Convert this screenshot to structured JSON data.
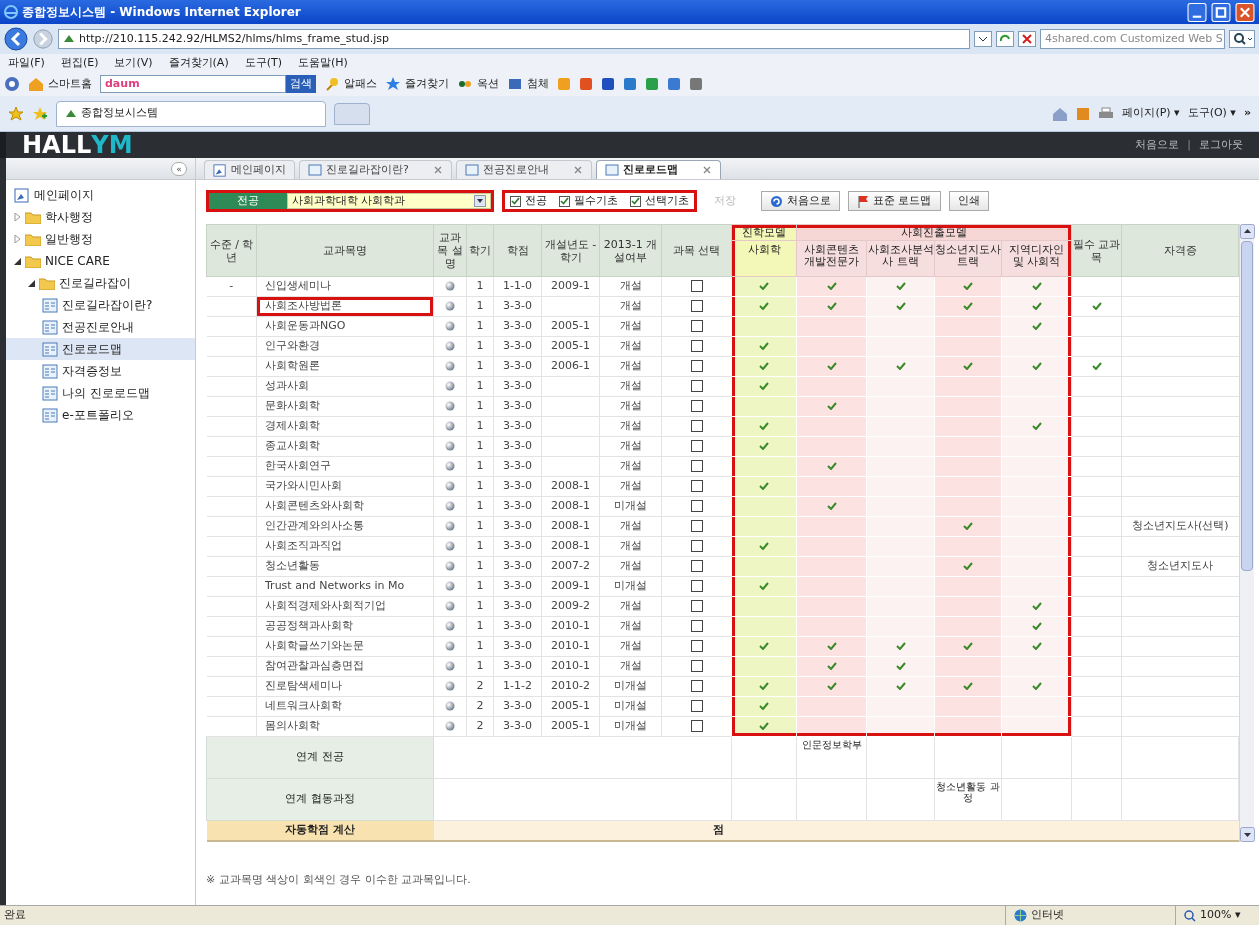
{
  "browser": {
    "title": "종합정보시스템 - Windows Internet Explorer",
    "url": "http://210.115.242.92/HLMS2/hlms/hlms_frame_stud.jsp",
    "search_text": "4shared.com Customized Web S",
    "menu": [
      "파일(F)",
      "편집(E)",
      "보기(V)",
      "즐겨찾기(A)",
      "도구(T)",
      "도움말(H)"
    ],
    "home": "스마트홈",
    "search_brand": "daum",
    "search_button": "검색",
    "links": [
      "알패스",
      "즐겨찾기",
      "옥션",
      "첨체"
    ],
    "favorites_tab": "종합정보시스템",
    "commands": [
      "페이지(P) ▾",
      "도구(O) ▾"
    ],
    "chevron": "»"
  },
  "app": {
    "logo_parts": [
      "HALL",
      "YM"
    ],
    "header_links": [
      "처음으로",
      "로그아웃"
    ],
    "separator": "|",
    "collapse": "«"
  },
  "sidebar": {
    "items": [
      {
        "label": "메인페이지",
        "kind": "home",
        "selected": false
      },
      {
        "label": "학사행정",
        "kind": "folder",
        "expanded": false,
        "selected": false
      },
      {
        "label": "일반행정",
        "kind": "folder",
        "expanded": false,
        "selected": false
      },
      {
        "label": "NICE CARE",
        "kind": "folder",
        "expanded": true,
        "selected": false,
        "children": [
          {
            "label": "진로길라잡이",
            "kind": "folder",
            "expanded": true,
            "selected": false,
            "children": [
              {
                "label": "진로길라잡이란?",
                "kind": "page",
                "selected": false
              },
              {
                "label": "전공진로안내",
                "kind": "page",
                "selected": false
              },
              {
                "label": "진로로드맵",
                "kind": "page",
                "selected": true
              },
              {
                "label": "자격증정보",
                "kind": "page",
                "selected": false
              },
              {
                "label": "나의 진로로드맵",
                "kind": "page",
                "selected": false
              },
              {
                "label": "e-포트폴리오",
                "kind": "page",
                "selected": false
              }
            ]
          }
        ]
      }
    ]
  },
  "tabs": [
    {
      "label": "메인페이지",
      "selected": false
    },
    {
      "label": "진로길라잡이란?",
      "selected": false
    },
    {
      "label": "전공진로안내",
      "selected": false
    },
    {
      "label": "진로로드맵",
      "selected": true
    }
  ],
  "filter": {
    "label": "전공",
    "value": "사회과학대학 사회학과",
    "highlighted": true
  },
  "checkboxes": {
    "highlighted": true,
    "items": [
      {
        "label": "전공",
        "checked": true
      },
      {
        "label": "필수기초",
        "checked": true
      },
      {
        "label": "선택기초",
        "checked": true
      }
    ]
  },
  "buttons": [
    {
      "label": "저장",
      "disabled": true,
      "kind": "plain"
    },
    {
      "label": "처음으로",
      "disabled": false,
      "kind": "refresh"
    },
    {
      "label": "표준 로드맵",
      "disabled": false,
      "kind": "flag"
    },
    {
      "label": "인쇄",
      "disabled": false,
      "kind": "plain"
    }
  ],
  "table": {
    "columns": [
      "수준 / 학년",
      "교과목명",
      "교과목 설명",
      "학기",
      "학점",
      "개설년도 - 학기",
      "2013-1 개설여부",
      "과목 선택"
    ],
    "model_groups": [
      {
        "label": "진학모델",
        "tracks": [
          "사회학"
        ]
      },
      {
        "label": "사회진출모델",
        "tracks": [
          "사회콘텐츠 개발전문가",
          "사회조사분석사 트랙",
          "청소년지도사 트랙",
          "지역디자인 및 사회적"
        ]
      }
    ],
    "models_highlighted": true,
    "tail_columns": [
      "필수 교과목",
      "자격증"
    ],
    "rows": [
      {
        "level": "-",
        "name": "신입생세미나",
        "semester": "1",
        "credits": "1-1-0",
        "opened": "2009-1",
        "status": "개설",
        "checked": false,
        "tracks": [
          true,
          true,
          true,
          true,
          true
        ],
        "required": false
      },
      {
        "name": "사회조사방법론",
        "highlighted": true,
        "semester": "1",
        "credits": "3-3-0",
        "status": "개설",
        "checked": false,
        "tracks": [
          true,
          true,
          true,
          true,
          true
        ],
        "required": true
      },
      {
        "name": "사회운동과NGO",
        "semester": "1",
        "credits": "3-3-0",
        "opened": "2005-1",
        "status": "개설",
        "checked": false,
        "tracks": [
          false,
          false,
          false,
          false,
          true
        ],
        "required": false
      },
      {
        "name": "인구와환경",
        "semester": "1",
        "credits": "3-3-0",
        "opened": "2005-1",
        "status": "개설",
        "checked": false,
        "tracks": [
          true,
          false,
          false,
          false,
          false
        ],
        "required": false
      },
      {
        "name": "사회학원론",
        "semester": "1",
        "credits": "3-3-0",
        "opened": "2006-1",
        "status": "개설",
        "checked": false,
        "tracks": [
          true,
          true,
          true,
          true,
          true
        ],
        "required": true
      },
      {
        "name": "성과사회",
        "semester": "1",
        "credits": "3-3-0",
        "status": "개설",
        "checked": false,
        "tracks": [
          true,
          false,
          false,
          false,
          false
        ],
        "required": false
      },
      {
        "name": "문화사회학",
        "semester": "1",
        "credits": "3-3-0",
        "status": "개설",
        "checked": false,
        "tracks": [
          false,
          true,
          false,
          false,
          false
        ],
        "required": false
      },
      {
        "name": "경제사회학",
        "semester": "1",
        "credits": "3-3-0",
        "status": "개설",
        "checked": false,
        "tracks": [
          true,
          false,
          false,
          false,
          true
        ],
        "required": false
      },
      {
        "name": "종교사회학",
        "semester": "1",
        "credits": "3-3-0",
        "status": "개설",
        "checked": false,
        "tracks": [
          true,
          false,
          false,
          false,
          false
        ],
        "required": false
      },
      {
        "name": "한국사회연구",
        "semester": "1",
        "credits": "3-3-0",
        "status": "개설",
        "checked": false,
        "tracks": [
          false,
          true,
          false,
          false,
          false
        ],
        "required": false
      },
      {
        "name": "국가와시민사회",
        "semester": "1",
        "credits": "3-3-0",
        "opened": "2008-1",
        "status": "개설",
        "checked": false,
        "tracks": [
          true,
          false,
          false,
          false,
          false
        ],
        "required": false
      },
      {
        "name": "사회콘텐츠와사회학",
        "semester": "1",
        "credits": "3-3-0",
        "opened": "2008-1",
        "status": "미개설",
        "checked": false,
        "tracks": [
          false,
          true,
          false,
          false,
          false
        ],
        "required": false
      },
      {
        "name": "인간관계와의사소통",
        "semester": "1",
        "credits": "3-3-0",
        "opened": "2008-1",
        "status": "개설",
        "checked": false,
        "tracks": [
          false,
          false,
          false,
          true,
          false
        ],
        "required": false,
        "cert": "청소년지도사(선택)"
      },
      {
        "name": "사회조직과직업",
        "semester": "1",
        "credits": "3-3-0",
        "opened": "2008-1",
        "status": "개설",
        "checked": false,
        "tracks": [
          true,
          false,
          false,
          false,
          false
        ],
        "required": false
      },
      {
        "name": "청소년활동",
        "semester": "1",
        "credits": "3-3-0",
        "opened": "2007-2",
        "status": "개설",
        "checked": false,
        "tracks": [
          false,
          false,
          false,
          true,
          false
        ],
        "required": false,
        "cert": "청소년지도사"
      },
      {
        "name": "Trust and Networks in Mo",
        "semester": "1",
        "credits": "3-3-0",
        "opened": "2009-1",
        "status": "미개설",
        "checked": false,
        "tracks": [
          true,
          false,
          false,
          false,
          false
        ],
        "required": false
      },
      {
        "name": "사회적경제와사회적기업",
        "semester": "1",
        "credits": "3-3-0",
        "opened": "2009-2",
        "status": "개설",
        "checked": false,
        "tracks": [
          false,
          false,
          false,
          false,
          true
        ],
        "required": false
      },
      {
        "name": "공공정책과사회학",
        "semester": "1",
        "credits": "3-3-0",
        "opened": "2010-1",
        "status": "개설",
        "checked": false,
        "tracks": [
          false,
          false,
          false,
          false,
          true
        ],
        "required": false
      },
      {
        "name": "사회학글쓰기와논문",
        "semester": "1",
        "credits": "3-3-0",
        "opened": "2010-1",
        "status": "개설",
        "checked": false,
        "tracks": [
          true,
          true,
          true,
          true,
          true
        ],
        "required": false
      },
      {
        "name": "참여관찰과심층면접",
        "semester": "1",
        "credits": "3-3-0",
        "opened": "2010-1",
        "status": "개설",
        "checked": false,
        "tracks": [
          false,
          true,
          true,
          false,
          false
        ],
        "required": false
      },
      {
        "name": "진로탐색세미나",
        "semester": "2",
        "credits": "1-1-2",
        "opened": "2010-2",
        "status": "미개설",
        "checked": false,
        "tracks": [
          true,
          true,
          true,
          true,
          true
        ],
        "required": false
      },
      {
        "name": "네트워크사회학",
        "semester": "2",
        "credits": "3-3-0",
        "opened": "2005-1",
        "status": "미개설",
        "checked": false,
        "tracks": [
          true,
          false,
          false,
          false,
          false
        ],
        "required": false
      },
      {
        "name": "몸의사회학",
        "semester": "2",
        "credits": "3-3-0",
        "opened": "2005-1",
        "status": "미개설",
        "checked": false,
        "tracks": [
          true,
          false,
          false,
          false,
          false
        ],
        "required": false
      }
    ],
    "links": [
      {
        "label": "연계 전공",
        "cells": [
          {
            "kind": "empty"
          },
          {
            "kind": "text",
            "text": "인문정보학부"
          },
          {
            "kind": "empty"
          },
          {
            "kind": "empty"
          },
          {
            "kind": "empty"
          }
        ]
      },
      {
        "label": "연계 협동과정",
        "cells": [
          {
            "kind": "empty"
          },
          {
            "kind": "empty"
          },
          {
            "kind": "empty"
          },
          {
            "kind": "text",
            "text": "청소년활동 과정"
          },
          {
            "kind": "empty"
          }
        ]
      }
    ],
    "total": {
      "label": "자동학점 계산",
      "value": "점"
    }
  },
  "note": "※ 교과목명 색상이 회색인 경우 이수한 교과목입니다.",
  "status_bar": {
    "text": "완료",
    "zone": "인터넷",
    "zoom": "100% ▾"
  }
}
